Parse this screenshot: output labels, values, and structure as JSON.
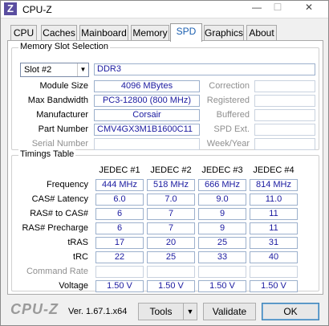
{
  "window": {
    "title": "CPU-Z",
    "icon_letter": "Z",
    "min": "—",
    "max": "☐",
    "close": "✕"
  },
  "tabs": [
    "CPU",
    "Caches",
    "Mainboard",
    "Memory",
    "SPD",
    "Graphics",
    "About"
  ],
  "active_tab": "SPD",
  "slot_group": {
    "title": "Memory Slot Selection",
    "slot_value": "Slot #2",
    "type": "DDR3",
    "rows": [
      {
        "label": "Module Size",
        "value": "4096 MBytes"
      },
      {
        "label": "Max Bandwidth",
        "value": "PC3-12800 (800 MHz)"
      },
      {
        "label": "Manufacturer",
        "value": "Corsair"
      },
      {
        "label": "Part Number",
        "value": "CMV4GX3M1B1600C11"
      },
      {
        "label": "Serial Number",
        "value": ""
      }
    ],
    "right_labels": [
      "Correction",
      "Registered",
      "Buffered",
      "SPD Ext.",
      "Week/Year"
    ]
  },
  "timings_group": {
    "title": "Timings Table",
    "columns": [
      "JEDEC #1",
      "JEDEC #2",
      "JEDEC #3",
      "JEDEC #4"
    ],
    "rows": [
      {
        "label": "Frequency",
        "values": [
          "444 MHz",
          "518 MHz",
          "666 MHz",
          "814 MHz"
        ]
      },
      {
        "label": "CAS# Latency",
        "values": [
          "6.0",
          "7.0",
          "9.0",
          "11.0"
        ]
      },
      {
        "label": "RAS# to CAS#",
        "values": [
          "6",
          "7",
          "9",
          "11"
        ]
      },
      {
        "label": "RAS# Precharge",
        "values": [
          "6",
          "7",
          "9",
          "11"
        ]
      },
      {
        "label": "tRAS",
        "values": [
          "17",
          "20",
          "25",
          "31"
        ]
      },
      {
        "label": "tRC",
        "values": [
          "22",
          "25",
          "33",
          "40"
        ]
      },
      {
        "label": "Command Rate",
        "values": [
          "",
          "",
          "",
          ""
        ]
      },
      {
        "label": "Voltage",
        "values": [
          "1.50 V",
          "1.50 V",
          "1.50 V",
          "1.50 V"
        ]
      }
    ]
  },
  "footer": {
    "logo": "CPU-Z",
    "version": "Ver. 1.67.1.x64",
    "tools": "Tools",
    "tools_arrow": "▼",
    "validate": "Validate",
    "ok": "OK"
  }
}
